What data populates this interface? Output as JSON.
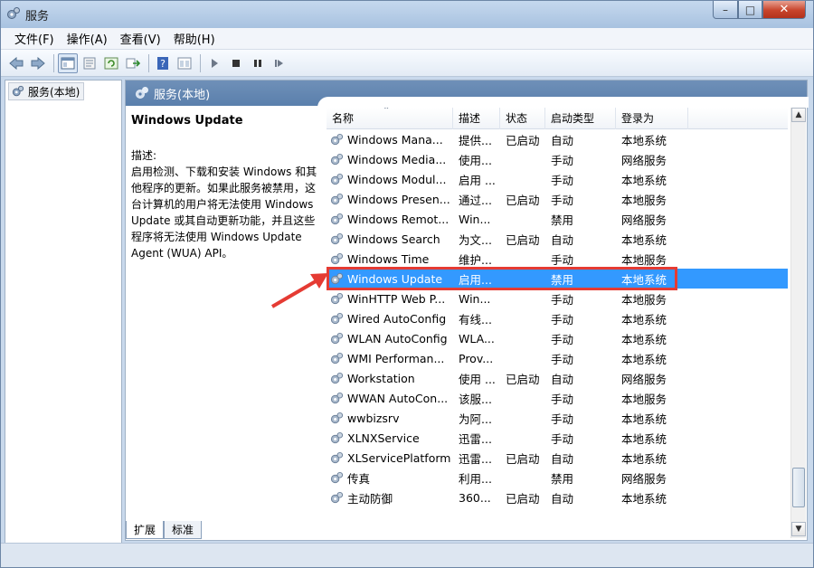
{
  "window": {
    "title": "服务",
    "min": "–",
    "max": "□",
    "close": "✕"
  },
  "menu": [
    "文件(F)",
    "操作(A)",
    "查看(V)",
    "帮助(H)"
  ],
  "toolbar": {
    "icons": [
      "back-icon",
      "forward-icon",
      "console-icon",
      "properties-icon",
      "refresh-icon",
      "export-icon",
      "help-icon",
      "details-icon",
      "play-icon",
      "stop-icon",
      "pause-icon",
      "resume-icon"
    ]
  },
  "tree": {
    "root_label": "服务(本地)"
  },
  "pane": {
    "header": "服务(本地)",
    "selected_title": "Windows Update",
    "desc_label": "描述:",
    "desc_text": "启用检测、下载和安装 Windows 和其他程序的更新。如果此服务被禁用，这台计算机的用户将无法使用 Windows Update 或其自动更新功能，并且这些程序将无法使用 Windows Update Agent (WUA) API。"
  },
  "columns": [
    "名称",
    "描述",
    "状态",
    "启动类型",
    "登录为"
  ],
  "rows": [
    {
      "name": "Windows Mana...",
      "desc": "提供...",
      "status": "已启动",
      "start": "自动",
      "logon": "本地系统"
    },
    {
      "name": "Windows Media...",
      "desc": "使用...",
      "status": "",
      "start": "手动",
      "logon": "网络服务"
    },
    {
      "name": "Windows Modul...",
      "desc": "启用 ...",
      "status": "",
      "start": "手动",
      "logon": "本地系统"
    },
    {
      "name": "Windows Presen...",
      "desc": "通过...",
      "status": "已启动",
      "start": "手动",
      "logon": "本地服务"
    },
    {
      "name": "Windows Remot...",
      "desc": "Win...",
      "status": "",
      "start": "禁用",
      "logon": "网络服务"
    },
    {
      "name": "Windows Search",
      "desc": "为文...",
      "status": "已启动",
      "start": "自动",
      "logon": "本地系统"
    },
    {
      "name": "Windows Time",
      "desc": "维护...",
      "status": "",
      "start": "手动",
      "logon": "本地服务"
    },
    {
      "name": "Windows Update",
      "desc": "启用...",
      "status": "",
      "start": "禁用",
      "logon": "本地系统"
    },
    {
      "name": "WinHTTP Web P...",
      "desc": "Win...",
      "status": "",
      "start": "手动",
      "logon": "本地服务"
    },
    {
      "name": "Wired AutoConfig",
      "desc": "有线...",
      "status": "",
      "start": "手动",
      "logon": "本地系统"
    },
    {
      "name": "WLAN AutoConfig",
      "desc": "WLA...",
      "status": "",
      "start": "手动",
      "logon": "本地系统"
    },
    {
      "name": "WMI Performan...",
      "desc": "Prov...",
      "status": "",
      "start": "手动",
      "logon": "本地系统"
    },
    {
      "name": "Workstation",
      "desc": "使用 ...",
      "status": "已启动",
      "start": "自动",
      "logon": "网络服务"
    },
    {
      "name": "WWAN AutoCon...",
      "desc": "该服...",
      "status": "",
      "start": "手动",
      "logon": "本地服务"
    },
    {
      "name": "wwbizsrv",
      "desc": "为阿...",
      "status": "",
      "start": "手动",
      "logon": "本地系统"
    },
    {
      "name": "XLNXService",
      "desc": "迅雷...",
      "status": "",
      "start": "手动",
      "logon": "本地系统"
    },
    {
      "name": "XLServicePlatform",
      "desc": "迅雷...",
      "status": "已启动",
      "start": "自动",
      "logon": "本地系统"
    },
    {
      "name": "传真",
      "desc": "利用...",
      "status": "",
      "start": "禁用",
      "logon": "网络服务"
    },
    {
      "name": "主动防御",
      "desc": "360...",
      "status": "已启动",
      "start": "自动",
      "logon": "本地系统"
    }
  ],
  "selected_row": 7,
  "bottom_tabs": [
    "扩展",
    "标准"
  ],
  "colors": {
    "selection": "#3399ff",
    "highlight": "#e53b33",
    "header": "#5a7fac"
  }
}
